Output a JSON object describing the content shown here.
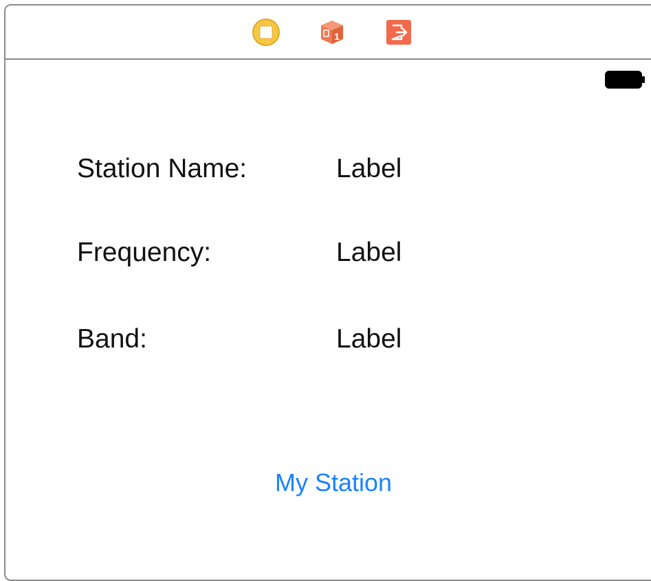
{
  "dock": {
    "icons": [
      "view-controller-icon",
      "first-responder-icon",
      "exit-icon"
    ],
    "colors": {
      "view_controller": "#f7c744",
      "first_responder": "#f07a52",
      "exit": "#f26a4b"
    }
  },
  "status_bar": {
    "battery_icon": "battery-full-icon"
  },
  "form": {
    "rows": [
      {
        "field": "Station Name:",
        "value": "Label"
      },
      {
        "field": "Frequency:",
        "value": "Label"
      },
      {
        "field": "Band:",
        "value": "Label"
      }
    ]
  },
  "button": {
    "label": "My Station",
    "color": "#1a82fb"
  }
}
